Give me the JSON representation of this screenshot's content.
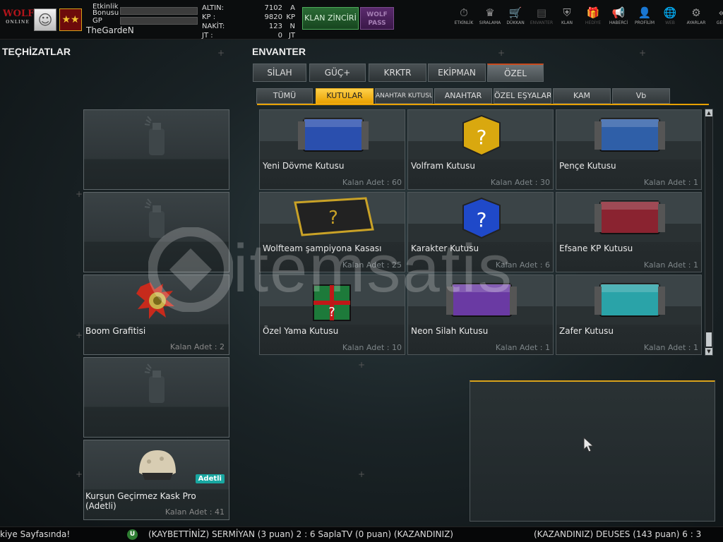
{
  "player": {
    "logo_text": "WOLF",
    "logo_sub": "ONLINE",
    "username": "TheGardeN",
    "bonus_label_line1": "Etkinlik",
    "bonus_label_line2": "Bonusu",
    "gp_label": "GP",
    "bonus_progress": 0,
    "gp_progress": 0
  },
  "currency": [
    {
      "name": "ALTIN:",
      "value": "7102",
      "unit": "A"
    },
    {
      "name": "KP    :",
      "value": "9820",
      "unit": "KP"
    },
    {
      "name": "NAKİT:",
      "value": "123",
      "unit": "N"
    },
    {
      "name": "JT    :",
      "value": "0",
      "unit": "JT"
    }
  ],
  "buttons": {
    "klan_zinciri": "KLAN ZİNCİRİ",
    "wolf_pass_1": "WOLF",
    "wolf_pass_2": "PASS"
  },
  "nav": [
    {
      "label": "ETKİNLİK",
      "icon": "⏱",
      "enabled": true
    },
    {
      "label": "SIRALAMA",
      "icon": "♛",
      "enabled": true
    },
    {
      "label": "DÜKKAN",
      "icon": "🛒",
      "enabled": true
    },
    {
      "label": "ENVANTER",
      "icon": "▤",
      "enabled": false
    },
    {
      "label": "KLAN",
      "icon": "⛨",
      "enabled": true
    },
    {
      "label": "HEDİYE",
      "icon": "🎁",
      "enabled": false
    },
    {
      "label": "HABERCİ",
      "icon": "📢",
      "enabled": true
    },
    {
      "label": "PROFİLİM",
      "icon": "👤",
      "enabled": true
    },
    {
      "label": "WEB",
      "icon": "🌐",
      "enabled": false
    },
    {
      "label": "AYARLAR",
      "icon": "⚙",
      "enabled": true
    },
    {
      "label": "GERİ",
      "icon": "«",
      "enabled": true
    }
  ],
  "sections": {
    "equipment_title": "TEÇHİZATLAR",
    "inventory_title": "ENVANTER"
  },
  "equipment": [
    {
      "name": "",
      "count": "",
      "icon": "spray-can-icon",
      "badge": ""
    },
    {
      "name": "",
      "count": "",
      "icon": "spray-can-icon",
      "badge": ""
    },
    {
      "name": "Boom Grafitisi",
      "count": "Kalan Adet : 2",
      "icon": "boom-graffiti-icon",
      "badge": ""
    },
    {
      "name": "",
      "count": "",
      "icon": "spray-can-icon",
      "badge": ""
    },
    {
      "name": "Kurşun Geçirmez Kask Pro (Adetli)",
      "count": "Kalan Adet : 41",
      "icon": "helmet-icon",
      "badge": "Adetli"
    }
  ],
  "tabs": [
    {
      "label": "SİLAH",
      "active": false
    },
    {
      "label": "GÜÇ+",
      "active": false
    },
    {
      "label": "KRKTR",
      "active": false
    },
    {
      "label": "EKİPMAN",
      "active": false
    },
    {
      "label": "ÖZEL",
      "active": true
    }
  ],
  "subtabs": [
    {
      "label": "TÜMÜ",
      "active": false
    },
    {
      "label": "KUTULAR",
      "active": true
    },
    {
      "label": "ANAHTAR KUTUSU",
      "active": false
    },
    {
      "label": "ANAHTAR",
      "active": false
    },
    {
      "label": "ÖZEL EŞYALAR",
      "active": false
    },
    {
      "label": "KAM",
      "active": false
    },
    {
      "label": "Vb",
      "active": false
    }
  ],
  "items": [
    {
      "name": "Yeni Dövme Kutusu",
      "count": "Kalan Adet : 60",
      "color": "#2a4fae",
      "kind": "crate"
    },
    {
      "name": "Volfram Kutusu",
      "count": "Kalan Adet : 30",
      "color": "#d9a80f",
      "kind": "mystery"
    },
    {
      "name": "Pençe Kutusu",
      "count": "Kalan Adet : 1",
      "color": "#2f5fa8",
      "kind": "crate"
    },
    {
      "name": "Wolfteam şampiyona Kasası",
      "count": "Kalan Adet : 25",
      "color": "#c9a227",
      "kind": "gold-crate"
    },
    {
      "name": "Karakter Kutusu",
      "count": "Kalan Adet : 6",
      "color": "#1f49c9",
      "kind": "mystery"
    },
    {
      "name": "Efsane KP Kutusu",
      "count": "Kalan Adet : 1",
      "color": "#8a2330",
      "kind": "crate"
    },
    {
      "name": "Özel Yama Kutusu",
      "count": "Kalan Adet : 10",
      "color": "#1d7a3a",
      "kind": "gift"
    },
    {
      "name": "Neon Silah Kutusu",
      "count": "Kalan Adet : 1",
      "color": "#6a3aa3",
      "kind": "crate"
    },
    {
      "name": "Zafer Kutusu",
      "count": "Kalan Adet : 1",
      "color": "#2aa3a8",
      "kind": "crate"
    }
  ],
  "watermark": "itemsatis",
  "ticker": {
    "left": "kiye Sayfasında!",
    "middle": "(KAYBETTİNİZ) SERMİYAN (3 puan) 2 : 6 SaplaTV (0 puan) (KAZANDINIZ)",
    "right": "(KAZANDINIZ) DEUSES (143 puan) 6 : 3",
    "icon_letter": "U"
  },
  "colors": {
    "accent_orange": "#e8a100",
    "active_tab_line": "#c94a1e",
    "klan_green": "#2a6b35",
    "wolf_purple": "#5a2a6d"
  }
}
